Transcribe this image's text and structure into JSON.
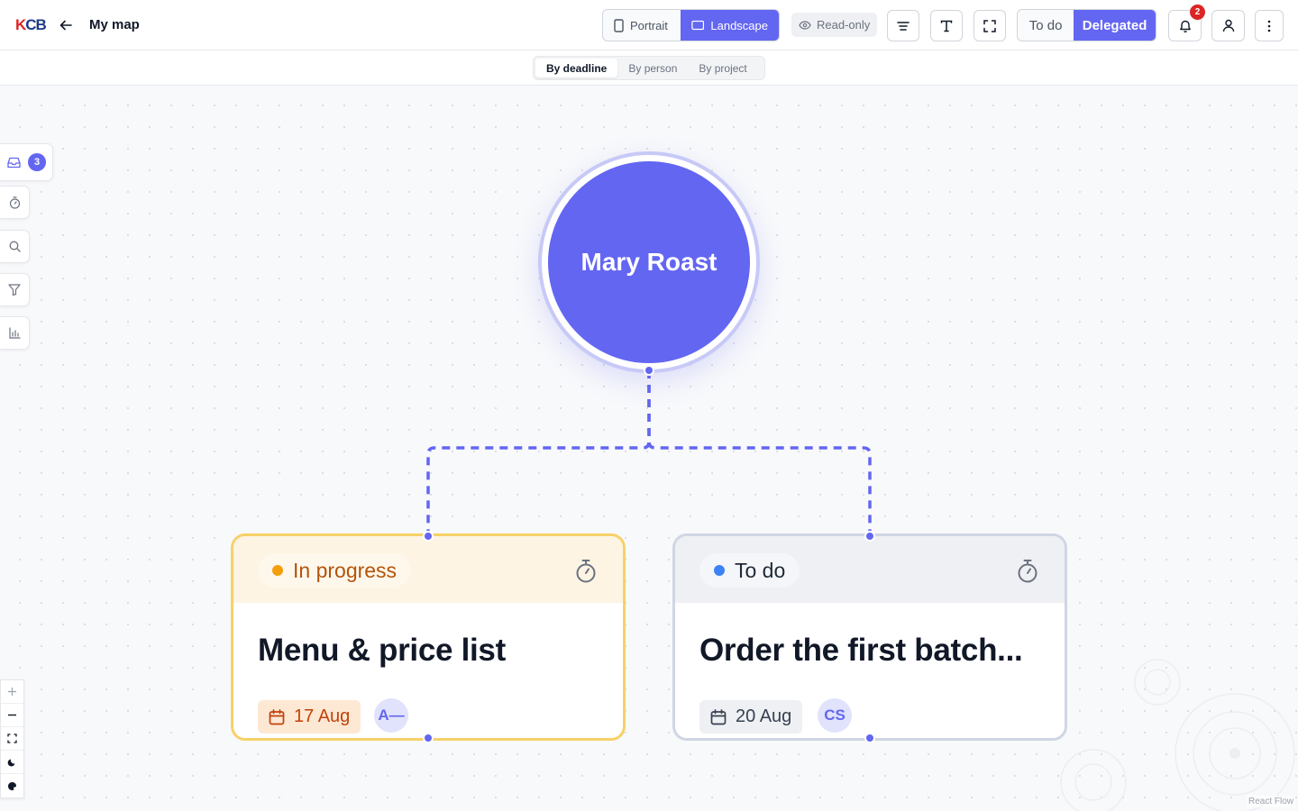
{
  "header": {
    "logo_k": "K",
    "logo_cb": "CB",
    "title": "My map",
    "orientation": {
      "portrait": "Portrait",
      "landscape": "Landscape",
      "selected": "Landscape"
    },
    "read_only": "Read-only",
    "view_mode": {
      "todo": "To do",
      "delegated": "Delegated",
      "selected": "Delegated"
    },
    "notification_count": "2"
  },
  "subbar": {
    "group_by": [
      "By deadline",
      "By person",
      "By project"
    ],
    "selected": "By deadline"
  },
  "map": {
    "root": {
      "label": "Mary Roast"
    },
    "tasks": [
      {
        "status": "In progress",
        "title": "Menu & price list",
        "date": "17 Aug",
        "assignee": "A—",
        "status_color": "#f59e0b"
      },
      {
        "status": "To do",
        "title": "Order the first batch...",
        "date": "20 Aug",
        "assignee": "CS",
        "status_color": "#3b82f6"
      }
    ]
  },
  "left_rail": {
    "inbox_count": "3",
    "items": [
      "inbox-icon",
      "timer-icon",
      "search-icon",
      "filter-icon",
      "chart-icon"
    ]
  },
  "zoom_controls": [
    "zoom-in-icon",
    "zoom-out-icon",
    "fit-view-icon",
    "dark-mode-icon",
    "theme-icon"
  ],
  "attribution": "React Flow",
  "colors": {
    "accent": "#6366f1",
    "in_progress": "#f59e0b",
    "todo": "#3b82f6",
    "notification": "#dc2626"
  }
}
